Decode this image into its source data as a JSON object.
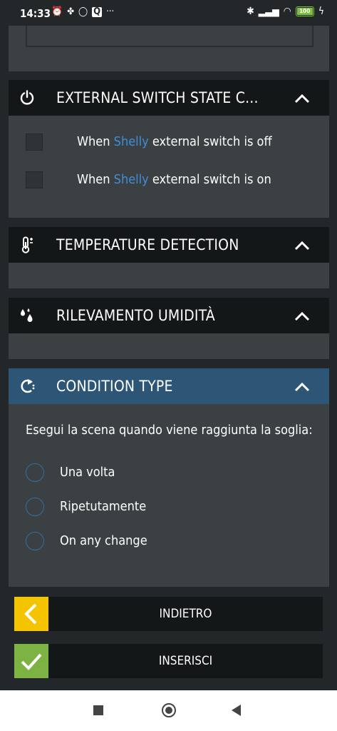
{
  "status_bar": {
    "time": "14:33",
    "left_icons": [
      "alarm-icon",
      "fan-icon",
      "whatsapp-icon",
      "q-app-icon"
    ],
    "more": "···",
    "q_label": "Q",
    "battery": "100"
  },
  "sections": {
    "external_switch": {
      "title": "EXTERNAL SWITCH STATE C...",
      "options": [
        {
          "prefix": "When ",
          "device": "Shelly",
          "suffix": " external switch is off"
        },
        {
          "prefix": "When ",
          "device": "Shelly",
          "suffix": " external switch is on"
        }
      ]
    },
    "temperature": {
      "title": "TEMPERATURE DETECTION"
    },
    "humidity": {
      "title": "RILEVAMENTO UMIDITÀ"
    },
    "condition": {
      "title": "CONDITION TYPE",
      "intro": "Esegui la scena quando viene raggiunta la soglia:",
      "options": [
        "Una volta",
        "Ripetutamente",
        "On any change"
      ]
    }
  },
  "buttons": {
    "back": "INDIETRO",
    "insert": "INSERISCI"
  },
  "colors": {
    "background": "#232729",
    "panel": "#3b4043",
    "header": "#141718",
    "header_active": "#2d5576",
    "highlight": "#3f8fd8",
    "back_button": "#f5c400",
    "insert_button": "#7cb342"
  }
}
